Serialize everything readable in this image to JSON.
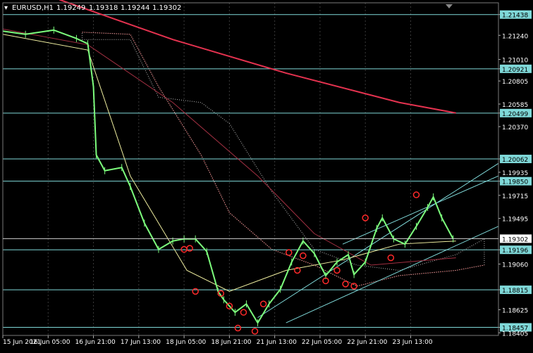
{
  "chart_data": {
    "type": "line",
    "symbol_header": {
      "symbol": "EURUSD,H1",
      "ohlc": [
        "1.19249",
        "1.19318",
        "1.19244",
        "1.19302"
      ]
    },
    "y_axis": {
      "ticks": [
        "1.21438",
        "1.21240",
        "1.21010",
        "1.20921",
        "1.20805",
        "1.20585",
        "1.20499",
        "1.20370",
        "1.20062",
        "1.19935",
        "1.19850",
        "1.19715",
        "1.19495",
        "1.19302",
        "1.19196",
        "1.19060",
        "1.18815",
        "1.18625",
        "1.18457",
        "1.18405"
      ],
      "ylim": [
        1.1838,
        1.2155
      ]
    },
    "x_axis": {
      "tick_labels": [
        "15 Jun 2021",
        "16 Jun 05:00",
        "16 Jun 21:00",
        "17 Jun 13:00",
        "18 Jun 05:00",
        "18 Jun 21:00",
        "21 Jun 13:00",
        "22 Jun 05:00",
        "22 Jun 21:00",
        "23 Jun 13:00"
      ],
      "tick_index": [
        0,
        16,
        32,
        48,
        64,
        80,
        96,
        112,
        128,
        144
      ]
    },
    "horizontal_levels": [
      {
        "value": 1.21438,
        "label": "1.21438"
      },
      {
        "value": 1.20921,
        "label": "1.20921"
      },
      {
        "value": 1.20499,
        "label": "1.20499"
      },
      {
        "value": 1.20062,
        "label": "1.20062"
      },
      {
        "value": 1.1985,
        "label": "1.19850"
      },
      {
        "value": 1.19196,
        "label": "1.19196"
      },
      {
        "value": 1.18815,
        "label": "1.18815"
      },
      {
        "value": 1.18457,
        "label": "1.18457"
      }
    ],
    "current_price": {
      "value": 1.19302,
      "label": "1.19302"
    },
    "price_points": [
      [
        0,
        1.2128
      ],
      [
        8,
        1.2125
      ],
      [
        18,
        1.2129
      ],
      [
        26,
        1.2121
      ],
      [
        30,
        1.2116
      ],
      [
        32,
        1.2075
      ],
      [
        33,
        1.201
      ],
      [
        36,
        1.1995
      ],
      [
        42,
        1.1998
      ],
      [
        45,
        1.198
      ],
      [
        50,
        1.1945
      ],
      [
        55,
        1.192
      ],
      [
        60,
        1.1928
      ],
      [
        64,
        1.193
      ],
      [
        68,
        1.193
      ],
      [
        72,
        1.1918
      ],
      [
        76,
        1.188
      ],
      [
        78,
        1.1872
      ],
      [
        82,
        1.186
      ],
      [
        86,
        1.1868
      ],
      [
        90,
        1.185
      ],
      [
        94,
        1.1868
      ],
      [
        98,
        1.1882
      ],
      [
        102,
        1.1908
      ],
      [
        106,
        1.1928
      ],
      [
        110,
        1.1916
      ],
      [
        114,
        1.1895
      ],
      [
        118,
        1.1908
      ],
      [
        122,
        1.1915
      ],
      [
        124,
        1.1896
      ],
      [
        128,
        1.1908
      ],
      [
        132,
        1.194
      ],
      [
        134,
        1.195
      ],
      [
        138,
        1.193
      ],
      [
        142,
        1.1925
      ],
      [
        146,
        1.1942
      ],
      [
        150,
        1.196
      ],
      [
        152,
        1.197
      ],
      [
        155,
        1.195
      ],
      [
        159,
        1.193
      ]
    ],
    "moving_averages": [
      {
        "color": "#e4324f",
        "points": [
          [
            20,
            1.2158
          ],
          [
            60,
            1.212
          ],
          [
            100,
            1.2088
          ],
          [
            140,
            1.206
          ],
          [
            160,
            1.205
          ]
        ]
      },
      {
        "color": "#a23042",
        "points": [
          [
            0,
            1.213
          ],
          [
            30,
            1.2115
          ],
          [
            60,
            1.206
          ],
          [
            90,
            1.199
          ],
          [
            110,
            1.1935
          ],
          [
            130,
            1.1905
          ],
          [
            160,
            1.1912
          ]
        ]
      },
      {
        "color": "#f0efa0",
        "points": [
          [
            0,
            1.2125
          ],
          [
            30,
            1.211
          ],
          [
            45,
            1.199
          ],
          [
            65,
            1.19
          ],
          [
            80,
            1.188
          ],
          [
            100,
            1.19
          ],
          [
            120,
            1.191
          ],
          [
            140,
            1.1925
          ],
          [
            160,
            1.1928
          ]
        ]
      }
    ],
    "ichimoku_cloud": [
      [
        28,
        1.212,
        1.2127
      ],
      [
        45,
        1.212,
        1.2125
      ],
      [
        55,
        1.2065,
        1.2075
      ],
      [
        70,
        1.206,
        1.201
      ],
      [
        80,
        1.204,
        1.1955
      ],
      [
        95,
        1.1975,
        1.192
      ],
      [
        110,
        1.192,
        1.1905
      ],
      [
        125,
        1.1905,
        1.1885
      ],
      [
        140,
        1.19,
        1.1895
      ],
      [
        160,
        1.1915,
        1.19
      ],
      [
        170,
        1.193,
        1.1905
      ]
    ],
    "trendlines": [
      {
        "from": [
          90,
          1.1855
        ],
        "to": [
          175,
          1.2002
        ]
      },
      {
        "from": [
          120,
          1.1925
        ],
        "to": [
          175,
          1.199
        ]
      },
      {
        "from": [
          100,
          1.185
        ],
        "to": [
          175,
          1.1942
        ]
      }
    ],
    "fractal_marks": [
      [
        64,
        1.192
      ],
      [
        66,
        1.1921
      ],
      [
        68,
        1.188
      ],
      [
        77,
        1.1878
      ],
      [
        80,
        1.1866
      ],
      [
        85,
        1.186
      ],
      [
        83,
        1.1845
      ],
      [
        89,
        1.1842
      ],
      [
        92,
        1.1868
      ],
      [
        101,
        1.1917
      ],
      [
        104,
        1.19
      ],
      [
        106,
        1.1914
      ],
      [
        114,
        1.189
      ],
      [
        118,
        1.19
      ],
      [
        121,
        1.1887
      ],
      [
        124,
        1.1885
      ],
      [
        128,
        1.195
      ],
      [
        137,
        1.1912
      ],
      [
        146,
        1.1972
      ]
    ],
    "colors": {
      "background": "#000000",
      "candles": "#7cfc7c",
      "grid": "#3a3a3a",
      "level_line": "#7fd8d8",
      "label_bg": "#7fd8d8",
      "current_bg": "#ffffff",
      "fractal": "#ff2a2a",
      "axis_text": "#ffffff"
    }
  }
}
